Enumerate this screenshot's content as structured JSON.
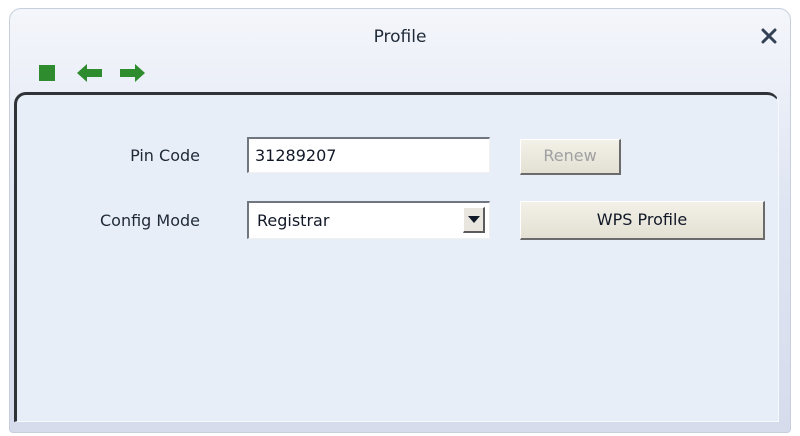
{
  "window": {
    "title": "Profile"
  },
  "icons": {
    "close": "close-icon",
    "stop": "stop-square-icon",
    "back": "arrow-left-icon",
    "forward": "arrow-right-icon",
    "dropdown": "chevron-down-icon"
  },
  "form": {
    "pin_code_label": "Pin Code",
    "pin_code_value": "31289207",
    "renew_label": "Renew",
    "config_mode_label": "Config Mode",
    "config_mode_selected": "Registrar",
    "wps_profile_label": "WPS Profile"
  },
  "colors": {
    "toolbar_green": "#2e8b2e",
    "close_blue": "#334155",
    "panel_bg": "#e7eef8"
  }
}
